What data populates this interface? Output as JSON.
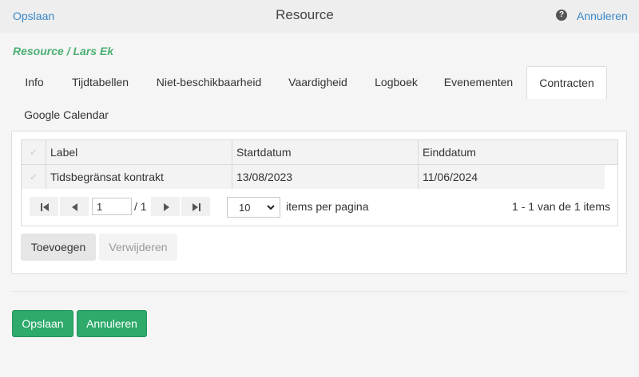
{
  "topbar": {
    "left_link": "Opslaan",
    "title": "Resource",
    "help_icon": "?",
    "right_link": "Annuleren"
  },
  "breadcrumb": "Resource / Lars Ek",
  "tabs": [
    {
      "label": "Info",
      "active": false
    },
    {
      "label": "Tijdtabellen",
      "active": false
    },
    {
      "label": "Niet-beschikbaarheid",
      "active": false
    },
    {
      "label": "Vaardigheid",
      "active": false
    },
    {
      "label": "Logboek",
      "active": false
    },
    {
      "label": "Evenementen",
      "active": false
    },
    {
      "label": "Contracten",
      "active": true
    },
    {
      "label": "Google Calendar",
      "active": false
    }
  ],
  "grid": {
    "columns": [
      "Label",
      "Startdatum",
      "Einddatum"
    ],
    "rows": [
      {
        "label": "Tidsbegränsat kontrakt",
        "start": "13/08/2023",
        "end": "11/06/2024"
      }
    ]
  },
  "pager": {
    "page": "1",
    "of": "/ 1",
    "page_size": "10",
    "items_per_page": "items per pagina",
    "info": "1 - 1 van de 1 items"
  },
  "actions": {
    "add": "Toevoegen",
    "delete": "Verwijderen"
  },
  "footer": {
    "save": "Opslaan",
    "cancel": "Annuleren"
  },
  "colors": {
    "link": "#3a87c8",
    "breadcrumb": "#4caf72",
    "primary": "#2eaa6b"
  }
}
